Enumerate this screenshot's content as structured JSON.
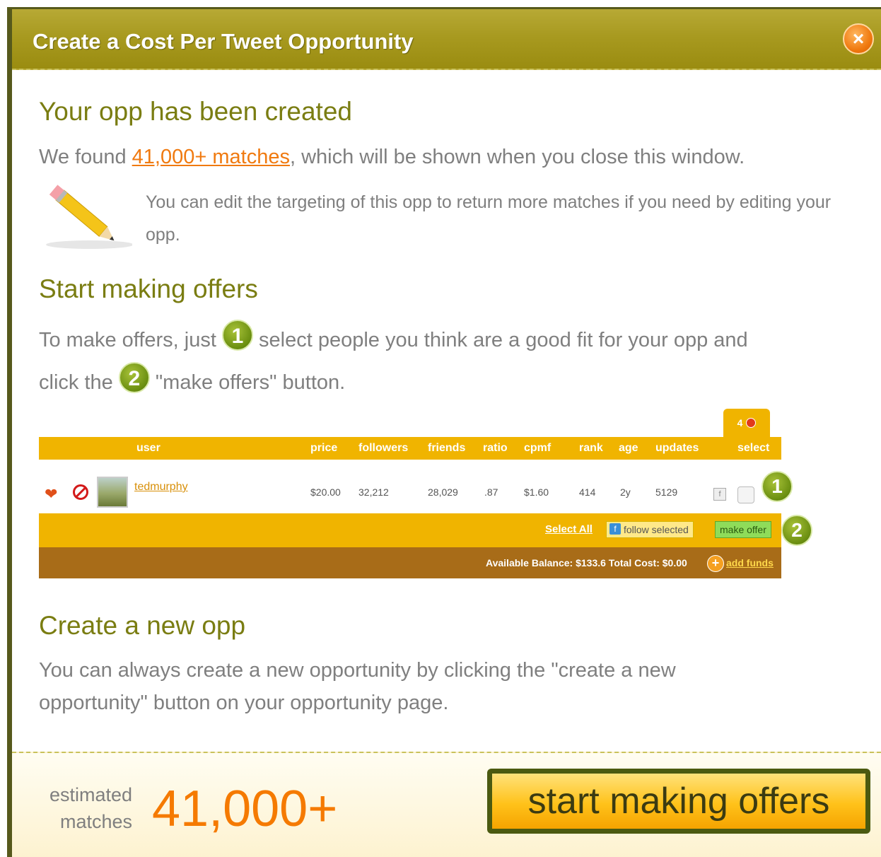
{
  "window": {
    "title": "Create a Cost Per Tweet Opportunity",
    "close_glyph": "×"
  },
  "section1": {
    "heading": "Your opp has been created",
    "found_prefix": "We found ",
    "found_link": "41,000+ matches",
    "found_suffix": ", which will be shown when you close this window.",
    "edit_note": "You can edit the targeting of this opp to return more matches if you need by editing your opp."
  },
  "section2": {
    "heading": "Start making offers",
    "line1_a": "To make offers, just",
    "badge1": "1",
    "line1_b": "select people you think are a good fit for your opp and",
    "line2_a": "click the",
    "badge2": "2",
    "line2_b": "\"make offers\" button."
  },
  "sample_table": {
    "tab_count": "4",
    "columns": [
      "user",
      "price",
      "followers",
      "friends",
      "ratio",
      "cpmf",
      "rank",
      "age",
      "updates",
      "select"
    ],
    "row": {
      "username": "tedmurphy",
      "price": "$20.00",
      "followers": "32,212",
      "friends": "28,029",
      "ratio": ".87",
      "cpmf": "$1.60",
      "rank": "414",
      "age": "2y",
      "updates": "5129"
    },
    "select_all": "Select All",
    "follow_selected": "follow selected",
    "make_offer": "make offer",
    "balance_text": "Available Balance: $133.6   Total Cost: $0.00",
    "add_funds": "add funds",
    "badge1": "1",
    "badge2": "2"
  },
  "section3": {
    "heading": "Create a new opp",
    "body": "You can always create a new opportunity by clicking the \"create a new opportunity\" button on your opportunity page."
  },
  "footer": {
    "estimated_label_1": "estimated",
    "estimated_label_2": "matches",
    "estimated_value": "41,000+",
    "start_button": "start making offers"
  }
}
